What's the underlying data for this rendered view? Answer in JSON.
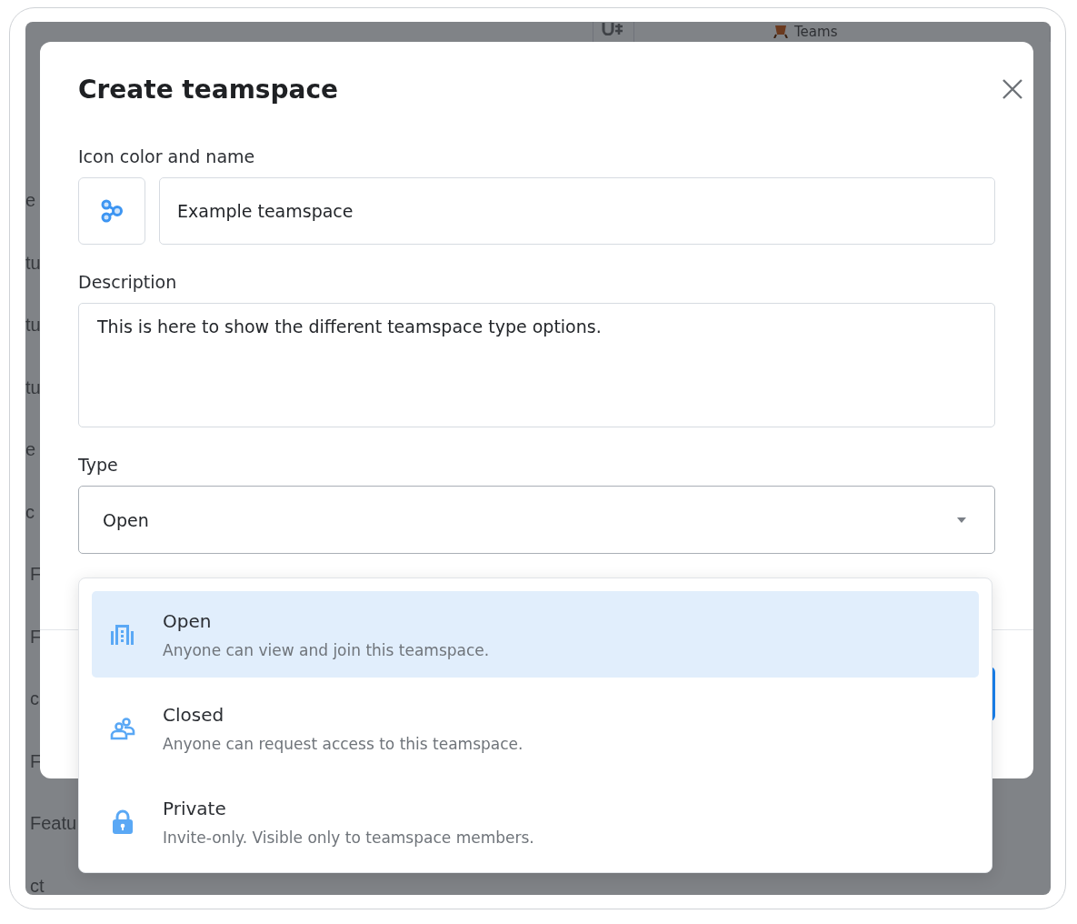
{
  "backdrop": {
    "header_label": "Teams",
    "side_fragments": [
      "e",
      "tu",
      "tu",
      "tu",
      "e",
      "c",
      "F",
      "F",
      "c",
      "F",
      "Featu",
      "ct"
    ]
  },
  "dialog": {
    "title": "Create teamspace",
    "name_field": {
      "label": "Icon color and name",
      "value": "Example teamspace"
    },
    "description_field": {
      "label": "Description",
      "value": "This is here to show the different teamspace type options."
    },
    "type_field": {
      "label": "Type",
      "value": "Open",
      "expanded": true
    },
    "type_options": [
      {
        "kind": "open",
        "title": "Open",
        "description": "Anyone can view and join this teamspace.",
        "selected": true
      },
      {
        "kind": "closed",
        "title": "Closed",
        "description": "Anyone can request access to this teamspace.",
        "selected": false
      },
      {
        "kind": "private",
        "title": "Private",
        "description": "Invite-only. Visible only to teamspace members.",
        "selected": false
      }
    ]
  }
}
